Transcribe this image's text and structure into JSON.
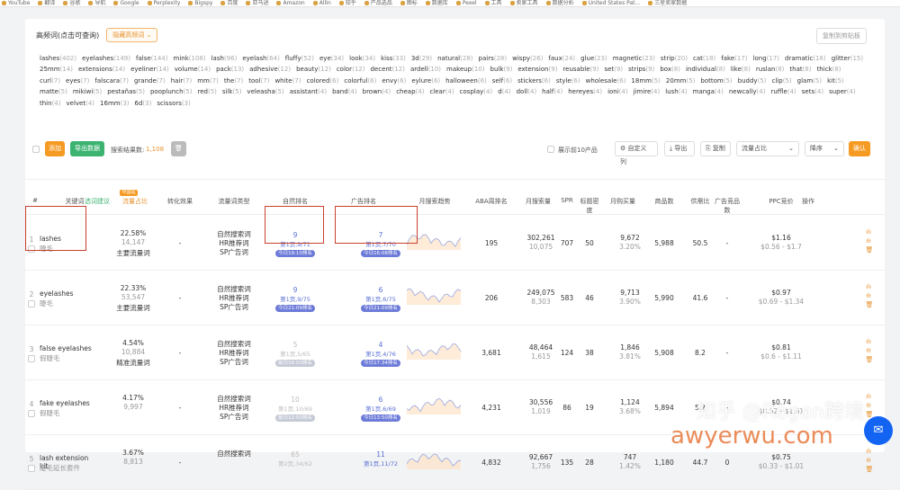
{
  "bookmarks": [
    "YouTube",
    "翻译",
    "谷歌",
    "导航",
    "Google",
    "Perplexity",
    "Bigspy",
    "百度",
    "亚马逊",
    "Amazon",
    "AllIn",
    "知乎",
    "产品选品",
    "图标",
    "数据库",
    "Pexel",
    "工具",
    "卖家工具",
    "数据分析",
    "United States Pat...",
    "三星卖家数据"
  ],
  "header": {
    "title": "高频词(点击可查询)",
    "dropdown": "隐藏高频词 ⌄",
    "copy_button": "复制到剪贴板"
  },
  "keywords": [
    [
      "lashes",
      "402"
    ],
    [
      "eyelashes",
      "149"
    ],
    [
      "false",
      "144"
    ],
    [
      "mink",
      "108"
    ],
    [
      "lash",
      "96"
    ],
    [
      "eyelash",
      "64"
    ],
    [
      "fluffy",
      "52"
    ],
    [
      "eye",
      "34"
    ],
    [
      "look",
      "34"
    ],
    [
      "kiss",
      "33"
    ],
    [
      "3d",
      "29"
    ],
    [
      "natural",
      "28"
    ],
    [
      "pairs",
      "28"
    ],
    [
      "wispy",
      "26"
    ],
    [
      "faux",
      "24"
    ],
    [
      "glue",
      "23"
    ],
    [
      "magnetic",
      "23"
    ],
    [
      "strip",
      "20"
    ],
    [
      "cat",
      "18"
    ],
    [
      "fake",
      "17"
    ],
    [
      "long",
      "17"
    ],
    [
      "dramatic",
      "16"
    ],
    [
      "glitter",
      "15"
    ],
    [
      "25mm",
      "14"
    ],
    [
      "extensions",
      "14"
    ],
    [
      "eyeliner",
      "14"
    ],
    [
      "volume",
      "14"
    ],
    [
      "pack",
      "13"
    ],
    [
      "adhesive",
      "12"
    ],
    [
      "beauty",
      "12"
    ],
    [
      "color",
      "12"
    ],
    [
      "decent",
      "12"
    ],
    [
      "ardell",
      "10"
    ],
    [
      "makeup",
      "10"
    ],
    [
      "bulk",
      "9"
    ],
    [
      "extension",
      "9"
    ],
    [
      "reusable",
      "9"
    ],
    [
      "set",
      "9"
    ],
    [
      "strips",
      "9"
    ],
    [
      "box",
      "8"
    ],
    [
      "individual",
      "8"
    ],
    [
      "like",
      "8"
    ],
    [
      "ruslan",
      "8"
    ],
    [
      "that",
      "8"
    ],
    [
      "thick",
      "8"
    ],
    [
      "curl",
      "7"
    ],
    [
      "eyes",
      "7"
    ],
    [
      "falscara",
      "7"
    ],
    [
      "grande",
      "7"
    ],
    [
      "hair",
      "7"
    ],
    [
      "mm",
      "7"
    ],
    [
      "the",
      "7"
    ],
    [
      "tool",
      "7"
    ],
    [
      "white",
      "7"
    ],
    [
      "colored",
      "6"
    ],
    [
      "colorful",
      "6"
    ],
    [
      "envy",
      "6"
    ],
    [
      "eylure",
      "6"
    ],
    [
      "halloween",
      "6"
    ],
    [
      "self",
      "6"
    ],
    [
      "stickers",
      "6"
    ],
    [
      "style",
      "6"
    ],
    [
      "wholesale",
      "6"
    ],
    [
      "18mm",
      "5"
    ],
    [
      "20mm",
      "5"
    ],
    [
      "bottom",
      "5"
    ],
    [
      "buddy",
      "5"
    ],
    [
      "clip",
      "5"
    ],
    [
      "glam",
      "5"
    ],
    [
      "kit",
      "5"
    ],
    [
      "matte",
      "5"
    ],
    [
      "mikiwi",
      "5"
    ],
    [
      "pestañas",
      "5"
    ],
    [
      "pooplunch",
      "5"
    ],
    [
      "red",
      "5"
    ],
    [
      "silk",
      "5"
    ],
    [
      "veleasha",
      "5"
    ],
    [
      "assistant",
      "4"
    ],
    [
      "band",
      "4"
    ],
    [
      "brown",
      "4"
    ],
    [
      "cheap",
      "4"
    ],
    [
      "clear",
      "4"
    ],
    [
      "cosplay",
      "4"
    ],
    [
      "d",
      "4"
    ],
    [
      "doll",
      "4"
    ],
    [
      "half",
      "4"
    ],
    [
      "hereyes",
      "4"
    ],
    [
      "ioni",
      "4"
    ],
    [
      "jimire",
      "4"
    ],
    [
      "lush",
      "4"
    ],
    [
      "manga",
      "4"
    ],
    [
      "newcally",
      "4"
    ],
    [
      "ruffle",
      "4"
    ],
    [
      "sets",
      "4"
    ],
    [
      "super",
      "4"
    ],
    [
      "thin",
      "4"
    ],
    [
      "velvet",
      "4"
    ],
    [
      "16mm",
      "3"
    ],
    [
      "6d",
      "3"
    ],
    [
      "scissors",
      "3"
    ]
  ],
  "toolbar": {
    "add_label": "添加",
    "export_label": "导出数据",
    "result_label": "搜索结果数:",
    "result_count": "1,108",
    "top10_label": "展示前10产品",
    "search_btn": "自定义列",
    "download_btn": "导出",
    "copy_btn": "复制",
    "sort_select": "流量占比",
    "order_select": "降序",
    "confirm": "确认"
  },
  "columns": [
    "#",
    "关键词",
    "流量占比",
    "转化效果",
    "流量词类型",
    "自然排名",
    "广告排名",
    "月搜索趋势",
    "ABA周排名",
    "月搜索量",
    "SPR",
    "标题密度",
    "月购买量",
    "商品数",
    "供需比",
    "广告竞品数",
    "PPC竞价",
    "操作"
  ],
  "col_badge": "中国站",
  "col_extra": "选词建议",
  "rows": [
    {
      "n": "1",
      "kw": "lashes",
      "cn": "睫毛",
      "share": "22.58%",
      "count": "14,147",
      "type": "主要流量词",
      "conv": "-",
      "t1": "自然搜索词",
      "t2": "HR推荐词",
      "t3": "SP广告词",
      "nat": "9",
      "natp": "第1页,9/71",
      "natt": "今日19:10排名",
      "ad": "7",
      "adp": "第1页,7/70",
      "adt": "今日16:08排名",
      "aba": "195",
      "ms": "302,261",
      "ms2": "10,075",
      "spr": "707",
      "td": "50",
      "buy": "9,672",
      "buyp": "3.20%",
      "goods": "5,988",
      "sd": "50.5",
      "adc": "-",
      "ppc": "$1.16",
      "ppcr": "$0.56 - $1.7",
      "g": false
    },
    {
      "n": "2",
      "kw": "eyelashes",
      "cn": "睫毛",
      "share": "22.33%",
      "count": "53,547",
      "type": "主要流量词",
      "conv": "-",
      "t1": "自然搜索词",
      "t2": "HR推荐词",
      "t3": "SP广告词",
      "nat": "9",
      "natp": "第1页,9/75",
      "natt": "今日21:09排名",
      "ad": "6",
      "adp": "第1页,6/75",
      "adt": "今日21:09排名",
      "aba": "206",
      "ms": "249,075",
      "ms2": "8,303",
      "spr": "583",
      "td": "46",
      "buy": "9,713",
      "buyp": "3.90%",
      "goods": "5,990",
      "sd": "41.6",
      "adc": "-",
      "ppc": "$0.97",
      "ppcr": "$0.69 - $1.34",
      "g": false
    },
    {
      "n": "3",
      "kw": "false eyelashes",
      "cn": "假睫毛",
      "share": "4.54%",
      "count": "10,884",
      "type": "精准流量词",
      "conv": "-",
      "t1": "自然搜索词",
      "t2": "HR推荐词",
      "t3": "SP广告词",
      "nat": "5",
      "natp": "第1页,5/65",
      "natt": "前日16:03排名",
      "ad": "4",
      "adp": "第1页,4/76",
      "adt": "今日17:34排名",
      "aba": "3,681",
      "ms": "48,464",
      "ms2": "1,615",
      "spr": "124",
      "td": "38",
      "buy": "1,846",
      "buyp": "3.81%",
      "goods": "5,908",
      "sd": "8.2",
      "adc": "-",
      "ppc": "$0.81",
      "ppcr": "$0.6 - $1.11",
      "g": true
    },
    {
      "n": "4",
      "kw": "fake eyelashes",
      "cn": "假睫毛",
      "share": "4.17%",
      "count": "9,997",
      "type": "",
      "conv": "-",
      "t1": "自然搜索词",
      "t2": "HR推荐词",
      "t3": "SP广告词",
      "nat": "10",
      "natp": "第1页,10/69",
      "natt": "前日12:50排名",
      "ad": "6",
      "adp": "第1页,6/69",
      "adt": "今日13:50排名",
      "aba": "4,231",
      "ms": "30,556",
      "ms2": "1,019",
      "spr": "86",
      "td": "19",
      "buy": "1,124",
      "buyp": "3.68%",
      "goods": "5,894",
      "sd": "5.2",
      "adc": "-",
      "ppc": "$0.74",
      "ppcr": "$0.62 - $1.61",
      "g": true
    },
    {
      "n": "5",
      "kw": "lash extension kit",
      "cn": "睫毛延长套件",
      "share": "3.67%",
      "count": "8,813",
      "type": "",
      "conv": "-",
      "t1": "自然搜索词",
      "t2": "",
      "t3": "",
      "nat": "65",
      "natp": "第2页,34/62",
      "natt": "",
      "ad": "11",
      "adp": "第1页,11/72",
      "adt": "",
      "aba": "4,832",
      "ms": "92,667",
      "ms2": "1,756",
      "spr": "135",
      "td": "28",
      "buy": "747",
      "buyp": "1.42%",
      "goods": "1,180",
      "sd": "44.7",
      "adc": "0",
      "ppc": "$0.75",
      "ppcr": "$0.33 - $1.01",
      "g": true
    }
  ],
  "watermark": "知乎 @Regan跨境",
  "watermark2": "awyerwu.com",
  "colors": {
    "accent": "#e7932f",
    "green": "#3cb371",
    "blue": "#5a6fd5",
    "red_box": "#c9412f"
  }
}
